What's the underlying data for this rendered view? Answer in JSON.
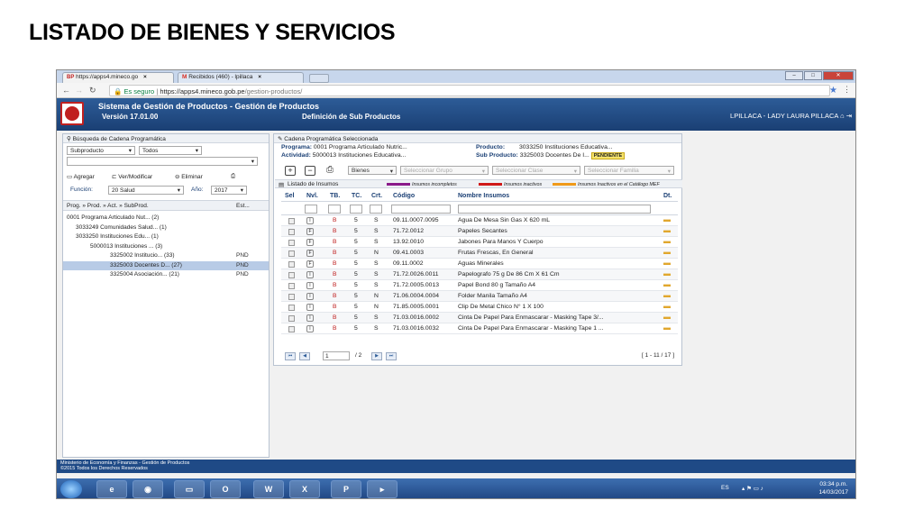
{
  "slide": {
    "title": "LISTADO DE BIENES Y SERVICIOS"
  },
  "browser": {
    "tabs": [
      {
        "label": "https://apps4.mineco.go",
        "close": "×"
      },
      {
        "label": "Recibidos (460) - lpillaca",
        "close": "×"
      }
    ],
    "url_secure": "Es seguro",
    "url_host": "https://apps4.mineco.gob.pe",
    "url_path": "/gestion-productos/"
  },
  "app": {
    "title": "Sistema de Gestión de Productos - Gestión de Productos",
    "version": "Versión 17.01.00",
    "subtitle": "Definición de Sub Productos",
    "user": "LPILLACA - LADY LAURA PILLACA"
  },
  "left": {
    "panel_title": "Búsqueda de Cadena Programática",
    "select_type": "Subproducto",
    "select_filter": "Todos",
    "btn_add": "Agregar",
    "btn_view": "Ver/Modificar",
    "btn_delete": "Eliminar",
    "funcion_label": "Función:",
    "funcion_value": "20 Salud",
    "anio_label": "Año:",
    "anio_value": "2017",
    "tree_header": "Prog. » Prod. » Act. » SubProd.",
    "tree_status_header": "Est...",
    "tree": [
      {
        "text": "0001 Programa Articulado Nut... (2)",
        "status": ""
      },
      {
        "text": "3033249 Comunidades Salud... (1)",
        "status": ""
      },
      {
        "text": "3033250 Instituciones Edu... (1)",
        "status": ""
      },
      {
        "text": "5000013 Instituciones ... (3)",
        "status": ""
      },
      {
        "text": "3325002 Institucio... (33)",
        "status": "PND"
      },
      {
        "text": "3325003 Docentes D... (27)",
        "status": "PND"
      },
      {
        "text": "3325004 Asociación... (21)",
        "status": "PND"
      }
    ]
  },
  "right": {
    "panel_title": "Cadena Programática Seleccionada",
    "programa_label": "Programa:",
    "programa_value": "0001 Programa Articulado Nutric...",
    "actividad_label": "Actividad:",
    "actividad_value": "5000013 Instituciones Educativa...",
    "producto_label": "Producto:",
    "producto_value": "3033250 Instituciones Educativa...",
    "subproducto_label": "Sub Producto:",
    "subproducto_value": "3325003 Docentes De I...",
    "status_badge": "PENDIENTE",
    "filter_bienes": "Bienes",
    "filter_grupo": "Seleccionar Grupo",
    "filter_clase": "Seleccionar Clase",
    "filter_familia": "Seleccionar Familia",
    "list_title": "Listado de Insumos",
    "legend": [
      {
        "label": "Insumos incompletos",
        "color": "#8a1a8a"
      },
      {
        "label": "Insumos inactivos",
        "color": "#d01919"
      },
      {
        "label": "Insumos Inactivos en el Catálogo MEF",
        "color": "#f09a1a"
      }
    ],
    "columns": [
      "Sel",
      "Nvl.",
      "TB.",
      "TC.",
      "Crt.",
      "Código",
      "Nombre Insumos",
      "Dt."
    ],
    "rows": [
      {
        "nvl": "I",
        "tb": "B",
        "tc": "5",
        "crt": "S",
        "codigo": "09.11.0007.0095",
        "nombre": "Agua De Mesa Sin Gas X 620 mL"
      },
      {
        "nvl": "F",
        "tb": "B",
        "tc": "5",
        "crt": "S",
        "codigo": "71.72.0012",
        "nombre": "Papeles Secantes"
      },
      {
        "nvl": "F",
        "tb": "B",
        "tc": "5",
        "crt": "S",
        "codigo": "13.92.0010",
        "nombre": "Jabones Para Manos Y Cuerpo"
      },
      {
        "nvl": "F",
        "tb": "B",
        "tc": "5",
        "crt": "N",
        "codigo": "09.41.0003",
        "nombre": "Frutas Frescas, En General"
      },
      {
        "nvl": "F",
        "tb": "B",
        "tc": "5",
        "crt": "S",
        "codigo": "09.11.0002",
        "nombre": "Aguas Minerales"
      },
      {
        "nvl": "I",
        "tb": "B",
        "tc": "5",
        "crt": "S",
        "codigo": "71.72.0026.0011",
        "nombre": "Papelografo 75 g De 86 Cm X 61 Cm"
      },
      {
        "nvl": "I",
        "tb": "B",
        "tc": "5",
        "crt": "S",
        "codigo": "71.72.0005.0013",
        "nombre": "Papel Bond 80 g Tamaño A4"
      },
      {
        "nvl": "I",
        "tb": "B",
        "tc": "5",
        "crt": "N",
        "codigo": "71.06.0004.0004",
        "nombre": "Folder Manila Tamaño A4"
      },
      {
        "nvl": "I",
        "tb": "B",
        "tc": "5",
        "crt": "N",
        "codigo": "71.85.0005.0001",
        "nombre": "Clip De Metal Chico N° 1 X 100"
      },
      {
        "nvl": "I",
        "tb": "B",
        "tc": "5",
        "crt": "S",
        "codigo": "71.03.0016.0002",
        "nombre": "Cinta De Papel Para Enmascarar - Masking Tape 3/..."
      },
      {
        "nvl": "I",
        "tb": "B",
        "tc": "5",
        "crt": "S",
        "codigo": "71.03.0016.0032",
        "nombre": "Cinta De Papel Para Enmascarar - Masking Tape 1 ..."
      }
    ],
    "pager_page": "1",
    "pager_total": "/ 2",
    "pager_range": "[ 1 - 11 / 17 ]"
  },
  "footer": {
    "line1": "Ministerio de Economía y Finanzas - Gestión de Productos",
    "line2": "©2015 Todos los Derechos Reservados"
  },
  "taskbar": {
    "lang": "ES",
    "time": "03:34 p.m.",
    "date": "14/03/2017"
  }
}
